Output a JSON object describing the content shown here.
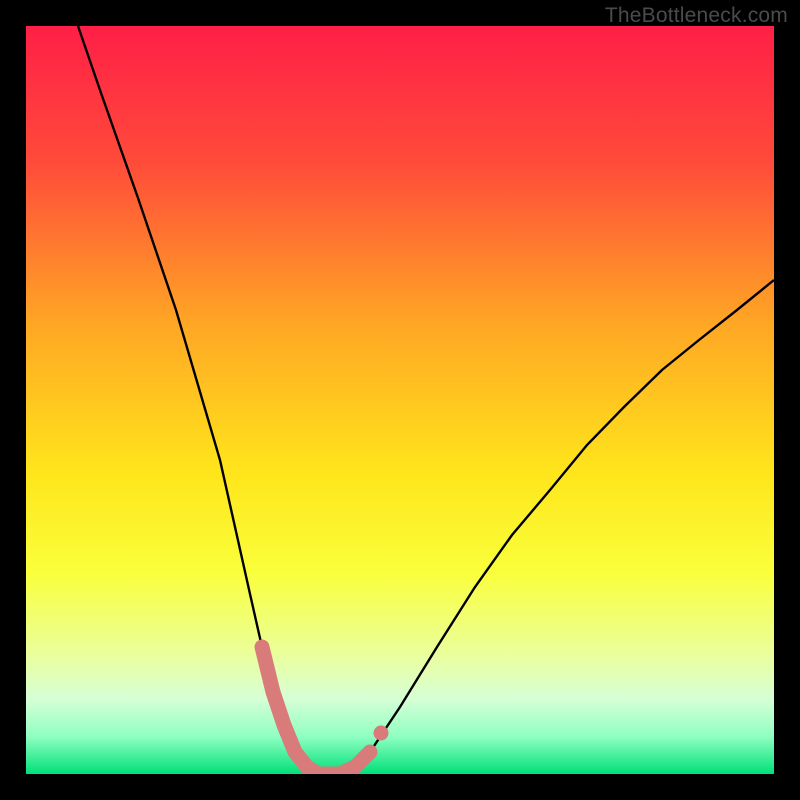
{
  "watermark": "TheBottleneck.com",
  "chart_data": {
    "type": "line",
    "title": "",
    "xlabel": "",
    "ylabel": "",
    "xlim": [
      0,
      100
    ],
    "ylim": [
      0,
      100
    ],
    "gradient_stops": [
      {
        "pct": 0,
        "color": "#ff1f47"
      },
      {
        "pct": 18,
        "color": "#ff4a3a"
      },
      {
        "pct": 40,
        "color": "#ffa724"
      },
      {
        "pct": 60,
        "color": "#ffe61b"
      },
      {
        "pct": 73,
        "color": "#f9ff3b"
      },
      {
        "pct": 84,
        "color": "#eaff9c"
      },
      {
        "pct": 90,
        "color": "#d6ffd6"
      },
      {
        "pct": 95,
        "color": "#8fffc1"
      },
      {
        "pct": 100,
        "color": "#00e07a"
      }
    ],
    "series": [
      {
        "name": "bottleneck-curve",
        "x": [
          7,
          10,
          15,
          20,
          23,
          26,
          28,
          30,
          31.5,
          33,
          34.5,
          36,
          37.5,
          39,
          42,
          44,
          46,
          50,
          55,
          60,
          65,
          70,
          75,
          80,
          85,
          90,
          95,
          100
        ],
        "y": [
          100,
          91,
          77,
          62,
          52,
          42,
          33,
          24,
          17,
          11,
          6.5,
          3,
          1,
          0,
          0,
          1,
          3,
          9,
          17,
          25,
          32,
          38,
          44,
          49,
          54,
          58,
          62,
          66
        ]
      }
    ],
    "highlight": {
      "name": "optimal-range",
      "color": "#d97b7b",
      "points_x": [
        31.5,
        33,
        34.5,
        36,
        37.5,
        39,
        42,
        44,
        46
      ],
      "points_y": [
        17,
        11,
        6.5,
        3,
        1,
        0,
        0,
        1,
        3
      ],
      "dot": {
        "x": 47.5,
        "y": 5.5
      }
    }
  }
}
